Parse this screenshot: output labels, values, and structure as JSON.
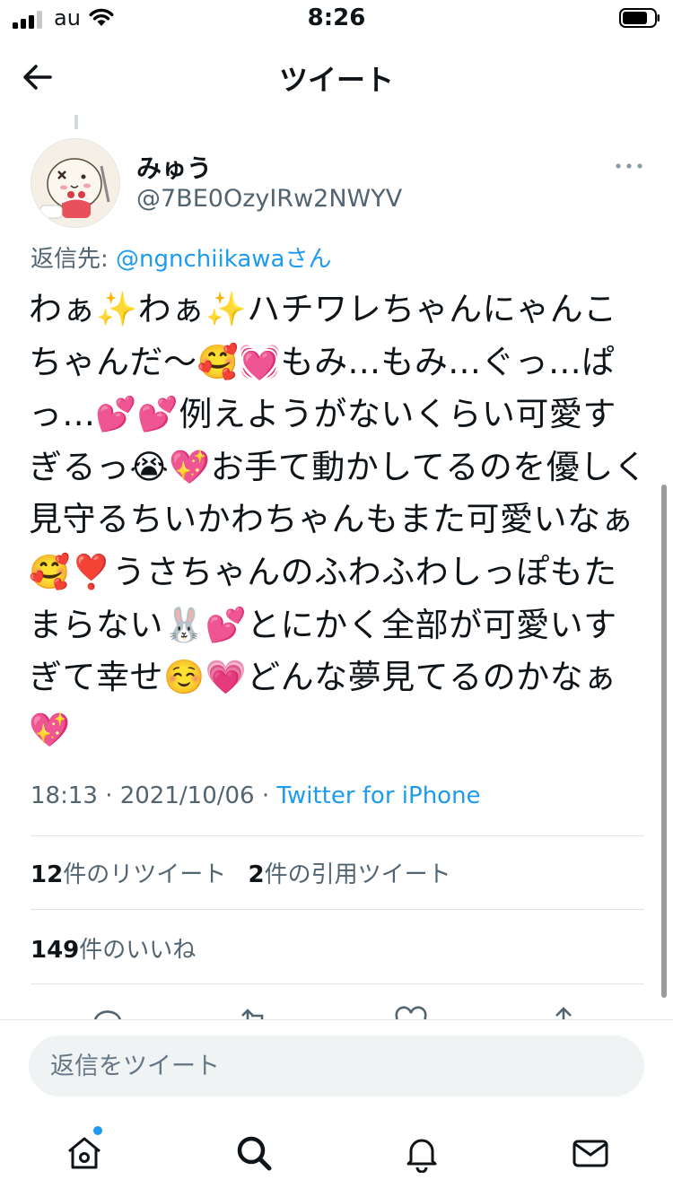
{
  "status_bar": {
    "carrier": "au",
    "time": "8:26"
  },
  "nav": {
    "title": "ツイート"
  },
  "tweet": {
    "author_name": "みゅう",
    "author_handle": "@7BE0OzyIRw2NWYV",
    "reply_to_prefix": "返信先: ",
    "reply_to_mention": "@ngnchiikawaさん",
    "text": "わぁ✨わぁ✨ハチワレちゃんにゃんこちゃんだ〜🥰💓もみ...もみ...ぐっ...ぱっ...💕💕例えようがないくらい可愛すぎるっ😭💖お手て動かしてるのを優しく見守るちいかわちゃんもまた可愛いなぁ🥰❣️うさちゃんのふわふわしっぽもたまらない🐰💕とにかく全部が可愛いすぎて幸せ☺️💗どんな夢見てるのかなぁ💖",
    "timestamp": "18:13 · 2021/10/06 · ",
    "source": "Twitter for iPhone",
    "retweet_count": "12",
    "retweet_label": "件のリツイート",
    "quote_count": "2",
    "quote_label": "件の引用ツイート",
    "like_count": "149",
    "like_label": "件のいいね"
  },
  "reply_box": {
    "placeholder": "返信をツイート"
  },
  "icons": {
    "back": "arrow-left-icon",
    "more": "more-dots-icon",
    "reply": "comment-icon",
    "retweet": "retweet-icon",
    "like": "heart-icon",
    "share": "share-icon",
    "home": "home-icon",
    "search": "search-icon",
    "notifications": "bell-icon",
    "messages": "mail-icon"
  },
  "colors": {
    "accent": "#1d9bf0",
    "text": "#0f1419",
    "secondary_text": "#536471",
    "divider": "#dfe4e8"
  }
}
